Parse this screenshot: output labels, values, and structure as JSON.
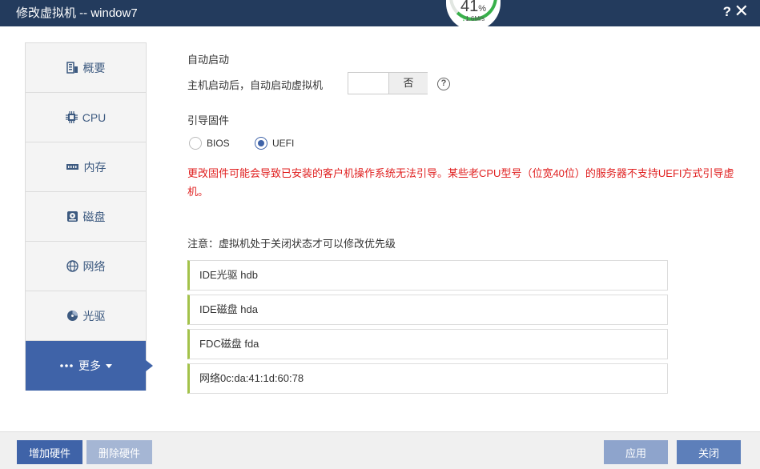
{
  "window": {
    "title": "修改虚拟机 -- window7",
    "help_label": "?",
    "close_label": "✕"
  },
  "speed": {
    "percent": "41",
    "percent_unit": "%",
    "rate_arrow": "↓",
    "rate": "1.6M/s",
    "progress": 0.41
  },
  "sidebar": {
    "items": [
      {
        "label": "概要",
        "icon": "server-icon"
      },
      {
        "label": "CPU",
        "icon": "cpu-icon"
      },
      {
        "label": "内存",
        "icon": "memory-icon"
      },
      {
        "label": "磁盘",
        "icon": "disk-icon"
      },
      {
        "label": "网络",
        "icon": "globe-icon"
      },
      {
        "label": "光驱",
        "icon": "cdrom-icon"
      },
      {
        "label": "更多",
        "icon": "more-icon",
        "active": true
      }
    ]
  },
  "autostart": {
    "section_title": "自动启动",
    "label": "主机启动后，自动启动虚拟机",
    "toggle_value": "否"
  },
  "firmware": {
    "section_title": "引导固件",
    "options": [
      {
        "label": "BIOS",
        "checked": false
      },
      {
        "label": "UEFI",
        "checked": true
      }
    ],
    "warning": "更改固件可能会导致已安装的客户机操作系统无法引导。某些老CPU型号（位宽40位）的服务器不支持UEFI方式引导虚机。"
  },
  "boot_order": {
    "note": "注意：虚拟机处于关闭状态才可以修改优先级",
    "items": [
      "IDE光驱 hdb",
      "IDE磁盘 hda",
      "FDC磁盘 fda",
      "网络0c:da:41:1d:60:78"
    ]
  },
  "footer": {
    "add_label": "增加硬件",
    "delete_label": "删除硬件",
    "apply_label": "应用",
    "close_label": "关闭"
  },
  "colors": {
    "titlebar": "#233b5d",
    "accent": "#3f63a8",
    "warning": "#e02020",
    "progress": "#38b04a"
  }
}
